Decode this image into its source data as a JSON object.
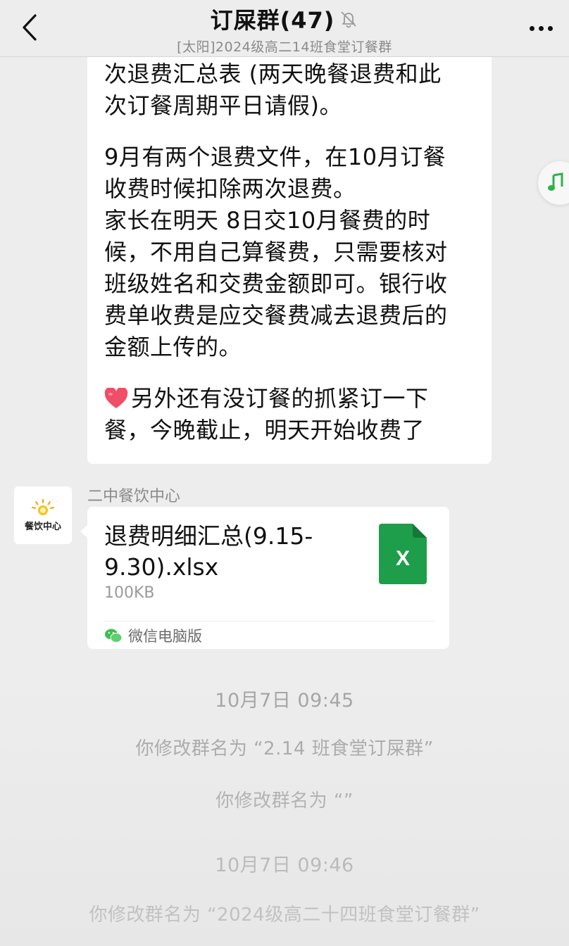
{
  "header": {
    "title": "订屎群(47)",
    "subtitle": "[太阳]2024级高二14班食堂订餐群",
    "back_icon": "chevron-left-icon",
    "mute_icon": "bell-off-icon",
    "more_icon": "more-horizontal-icon"
  },
  "message": {
    "lines": [
      "次退费汇总表 (两天晚餐退费和此",
      "次订餐周期平日请假)。",
      "",
      "9月有两个退费文件，在10月订餐",
      "收费时候扣除两次退费。",
      "家长在明天 8日交10月餐费的时",
      "候，不用自己算餐费，只需要核对",
      "班级姓名和交费金额即可。银行收",
      "费单收费是应交餐费减去退费后的",
      "金额上传的。",
      "",
      "另外还有没订餐的抓紧订一下",
      "餐，今晚截止，明天开始收费了"
    ],
    "heart_icon": "heart-emoji-icon"
  },
  "file_message": {
    "sender": "二中餐饮中心",
    "avatar_text": "餐饮中心",
    "file_name": "退费明细汇总(9.15-9.30).xlsx",
    "file_size": "100KB",
    "file_icon_letter": "X",
    "source": "微信电脑版"
  },
  "system": [
    {
      "text": "10月7日 09:45",
      "kind": "time"
    },
    {
      "text": "你修改群名为 “2.14 班食堂订屎群”",
      "kind": "notice"
    },
    {
      "text": "你修改群名为 “”",
      "kind": "notice"
    },
    {
      "text": "10月7日 09:46",
      "kind": "time"
    },
    {
      "text": "你修改群名为 “2024级高二十四班食堂订餐群”",
      "kind": "notice"
    }
  ],
  "colors": {
    "background": "#ededed",
    "bubble": "#ffffff",
    "excel_green": "#1e9e4a",
    "system_text": "#a3a3a3"
  }
}
